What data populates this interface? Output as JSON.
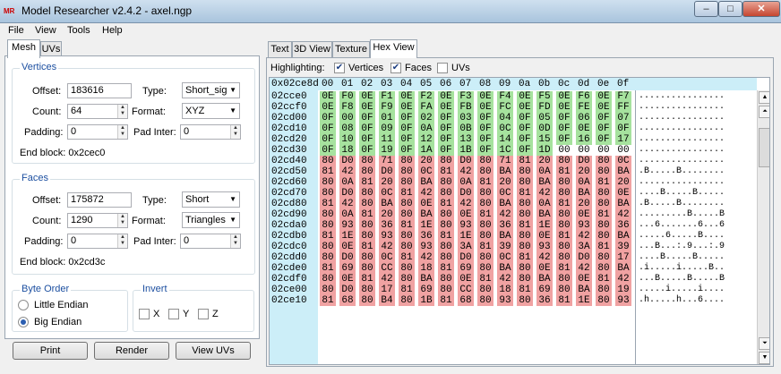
{
  "window": {
    "title": "Model Researcher v2.4.2 - axel.ngp",
    "icon_label": "MR",
    "min": "–",
    "max": "□",
    "close": "✕"
  },
  "menu": [
    "File",
    "View",
    "Tools",
    "Help"
  ],
  "left_tabs": [
    "Mesh",
    "UVs"
  ],
  "vertices": {
    "title": "Vertices",
    "offset_label": "Offset:",
    "offset": "183616",
    "type_label": "Type:",
    "type": "Short_sig",
    "count_label": "Count:",
    "count": "64",
    "format_label": "Format:",
    "format": "XYZ",
    "padding_label": "Padding:",
    "padding": "0",
    "padinter_label": "Pad Inter:",
    "padinter": "0",
    "endblock": "End block: 0x2cec0"
  },
  "faces": {
    "title": "Faces",
    "offset_label": "Offset:",
    "offset": "175872",
    "type_label": "Type:",
    "type": "Short",
    "count_label": "Count:",
    "count": "1290",
    "format_label": "Format:",
    "format": "Triangles",
    "padding_label": "Padding:",
    "padding": "0",
    "padinter_label": "Pad Inter:",
    "padinter": "0",
    "endblock": "End block: 0x2cd3c"
  },
  "byte_order": {
    "title": "Byte Order",
    "little": "Little Endian",
    "big": "Big Endian",
    "selected": "big"
  },
  "invert": {
    "title": "Invert",
    "x": "X",
    "y": "Y",
    "z": "Z"
  },
  "buttons": {
    "print": "Print",
    "render": "Render",
    "view_uvs": "View UVs"
  },
  "right_tabs": [
    "Text",
    "3D View",
    "Texture",
    "Hex View"
  ],
  "highlighting": {
    "label": "Highlighting:",
    "vertices": "Vertices",
    "faces": "Faces",
    "uvs": "UVs",
    "vertices_checked": true,
    "faces_checked": true,
    "uvs_checked": false
  },
  "hex": {
    "corner": "0x02ce8d",
    "columns": [
      "00",
      "01",
      "02",
      "03",
      "04",
      "05",
      "06",
      "07",
      "08",
      "09",
      "0a",
      "0b",
      "0c",
      "0d",
      "0e",
      "0f"
    ],
    "rows": [
      {
        "addr": "02cce0",
        "bytes": [
          "0E",
          "F0",
          "0E",
          "F1",
          "0E",
          "F2",
          "0E",
          "F3",
          "0E",
          "F4",
          "0E",
          "F5",
          "0E",
          "F6",
          "0E",
          "F7"
        ],
        "hl": "gggggggggggggggg",
        "ascii": "................"
      },
      {
        "addr": "02ccf0",
        "bytes": [
          "0E",
          "F8",
          "0E",
          "F9",
          "0E",
          "FA",
          "0E",
          "FB",
          "0E",
          "FC",
          "0E",
          "FD",
          "0E",
          "FE",
          "0E",
          "FF"
        ],
        "hl": "gggggggggggggggg",
        "ascii": "................"
      },
      {
        "addr": "02cd00",
        "bytes": [
          "0F",
          "00",
          "0F",
          "01",
          "0F",
          "02",
          "0F",
          "03",
          "0F",
          "04",
          "0F",
          "05",
          "0F",
          "06",
          "0F",
          "07"
        ],
        "hl": "gggggggggggggggg",
        "ascii": "................"
      },
      {
        "addr": "02cd10",
        "bytes": [
          "0F",
          "08",
          "0F",
          "09",
          "0F",
          "0A",
          "0F",
          "0B",
          "0F",
          "0C",
          "0F",
          "0D",
          "0F",
          "0E",
          "0F",
          "0F"
        ],
        "hl": "gggggggggggggggg",
        "ascii": "................"
      },
      {
        "addr": "02cd20",
        "bytes": [
          "0F",
          "10",
          "0F",
          "11",
          "0F",
          "12",
          "0F",
          "13",
          "0F",
          "14",
          "0F",
          "15",
          "0F",
          "16",
          "0F",
          "17"
        ],
        "hl": "gggggggggggggggg",
        "ascii": "................"
      },
      {
        "addr": "02cd30",
        "bytes": [
          "0F",
          "18",
          "0F",
          "19",
          "0F",
          "1A",
          "0F",
          "1B",
          "0F",
          "1C",
          "0F",
          "1D",
          "00",
          "00",
          "00",
          "00"
        ],
        "hl": "ggggggggggggwwww",
        "ascii": "................"
      },
      {
        "addr": "02cd40",
        "bytes": [
          "80",
          "D0",
          "80",
          "71",
          "80",
          "20",
          "80",
          "D0",
          "80",
          "71",
          "81",
          "20",
          "80",
          "D0",
          "80",
          "0C"
        ],
        "hl": "rrrrrrrrrrrrrrrr",
        "ascii": "................"
      },
      {
        "addr": "02cd50",
        "bytes": [
          "81",
          "42",
          "80",
          "D0",
          "80",
          "0C",
          "81",
          "42",
          "80",
          "BA",
          "80",
          "0A",
          "81",
          "20",
          "80",
          "BA"
        ],
        "hl": "rrrrrrrrrrrrrrrr",
        "ascii": ".B.....B........"
      },
      {
        "addr": "02cd60",
        "bytes": [
          "80",
          "0A",
          "81",
          "20",
          "80",
          "BA",
          "80",
          "0A",
          "81",
          "20",
          "80",
          "BA",
          "80",
          "0A",
          "81",
          "20"
        ],
        "hl": "rrrrrrrrrrrrrrrr",
        "ascii": "................"
      },
      {
        "addr": "02cd70",
        "bytes": [
          "80",
          "D0",
          "80",
          "0C",
          "81",
          "42",
          "80",
          "D0",
          "80",
          "0C",
          "81",
          "42",
          "80",
          "BA",
          "80",
          "0E"
        ],
        "hl": "rrrrrrrrrrrrrrrr",
        "ascii": "....B.....B....."
      },
      {
        "addr": "02cd80",
        "bytes": [
          "81",
          "42",
          "80",
          "BA",
          "80",
          "0E",
          "81",
          "42",
          "80",
          "BA",
          "80",
          "0A",
          "81",
          "20",
          "80",
          "BA"
        ],
        "hl": "rrrrrrrrrrrrrrrr",
        "ascii": ".B.....B........"
      },
      {
        "addr": "02cd90",
        "bytes": [
          "80",
          "0A",
          "81",
          "20",
          "80",
          "BA",
          "80",
          "0E",
          "81",
          "42",
          "80",
          "BA",
          "80",
          "0E",
          "81",
          "42"
        ],
        "hl": "rrrrrrrrrrrrrrrr",
        "ascii": ".........B.....B"
      },
      {
        "addr": "02cda0",
        "bytes": [
          "80",
          "93",
          "80",
          "36",
          "81",
          "1E",
          "80",
          "93",
          "80",
          "36",
          "81",
          "1E",
          "80",
          "93",
          "80",
          "36"
        ],
        "hl": "rrrrrrrrrrrrrrrr",
        "ascii": "...6.......6...6"
      },
      {
        "addr": "02cdb0",
        "bytes": [
          "81",
          "1E",
          "80",
          "93",
          "80",
          "36",
          "81",
          "1E",
          "80",
          "BA",
          "80",
          "0E",
          "81",
          "42",
          "80",
          "BA"
        ],
        "hl": "rrrrrrrrrrrrrrrr",
        "ascii": ".....6.....B...."
      },
      {
        "addr": "02cdc0",
        "bytes": [
          "80",
          "0E",
          "81",
          "42",
          "80",
          "93",
          "80",
          "3A",
          "81",
          "39",
          "80",
          "93",
          "80",
          "3A",
          "81",
          "39"
        ],
        "hl": "rrrrrrrrrrrrrrrr",
        "ascii": "...B...:.9...:.9"
      },
      {
        "addr": "02cdd0",
        "bytes": [
          "80",
          "D0",
          "80",
          "0C",
          "81",
          "42",
          "80",
          "D0",
          "80",
          "0C",
          "81",
          "42",
          "80",
          "D0",
          "80",
          "17"
        ],
        "hl": "rrrrrrrrrrrrrrrr",
        "ascii": "....B.....B....."
      },
      {
        "addr": "02cde0",
        "bytes": [
          "81",
          "69",
          "80",
          "CC",
          "80",
          "18",
          "81",
          "69",
          "80",
          "BA",
          "80",
          "0E",
          "81",
          "42",
          "80",
          "BA"
        ],
        "hl": "rrrrrrrrrrrrrrrr",
        "ascii": ".i.....i.....B.."
      },
      {
        "addr": "02cdf0",
        "bytes": [
          "80",
          "0E",
          "81",
          "42",
          "80",
          "BA",
          "80",
          "0E",
          "81",
          "42",
          "80",
          "BA",
          "80",
          "0E",
          "81",
          "42"
        ],
        "hl": "rrrrrrrrrrrrrrrr",
        "ascii": "...B.....B.....B"
      },
      {
        "addr": "02ce00",
        "bytes": [
          "80",
          "D0",
          "80",
          "17",
          "81",
          "69",
          "80",
          "CC",
          "80",
          "18",
          "81",
          "69",
          "80",
          "BA",
          "80",
          "19"
        ],
        "hl": "rrrrrrrrrrrrrrrr",
        "ascii": ".....i.....i...."
      },
      {
        "addr": "02ce10",
        "bytes": [
          "81",
          "68",
          "80",
          "B4",
          "80",
          "1B",
          "81",
          "68",
          "80",
          "93",
          "80",
          "36",
          "81",
          "1E",
          "80",
          "93"
        ],
        "hl": "rrrrrrrrrrrrrrrr",
        "ascii": ".h.....h...6...."
      }
    ]
  },
  "scroll": {
    "top": "▲",
    "top2": "⏶",
    "bottom": "▼",
    "bottom2": "⏷"
  }
}
